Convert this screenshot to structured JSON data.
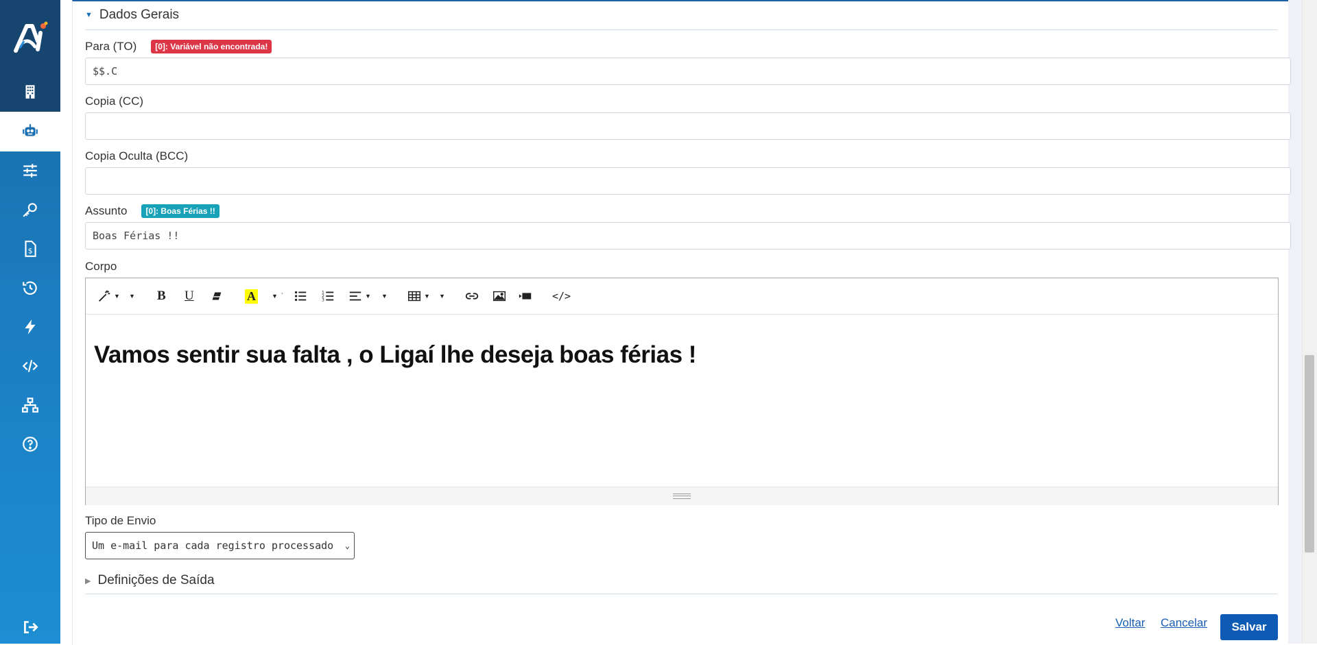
{
  "sidebar": {
    "items": [
      {
        "name": "building-icon"
      },
      {
        "name": "robot-icon",
        "active": true
      },
      {
        "name": "sliders-icon"
      },
      {
        "name": "key-icon"
      },
      {
        "name": "invoice-icon"
      },
      {
        "name": "history-icon"
      },
      {
        "name": "bolt-icon"
      },
      {
        "name": "code-icon"
      },
      {
        "name": "network-icon"
      },
      {
        "name": "help-icon"
      },
      {
        "name": "logout-icon"
      }
    ]
  },
  "section": {
    "title": "Dados Gerais",
    "section2_title": "Definições de Saída"
  },
  "fields": {
    "to_label": "Para (TO)",
    "to_badge": "[0]: Variável não encontrada!",
    "to_value": "$$.C",
    "cc_label": "Copia (CC)",
    "cc_value": "",
    "bcc_label": "Copia Oculta (BCC)",
    "bcc_value": "",
    "subject_label": "Assunto",
    "subject_badge": "[0]: Boas Férias !!",
    "subject_value": "Boas Férias !!",
    "body_label": "Corpo",
    "body_content": "Vamos sentir sua falta , o Ligaí lhe deseja boas férias !",
    "send_type_label": "Tipo de Envio",
    "send_type_value": "Um e-mail para cada registro processado"
  },
  "actions": {
    "back": "Voltar",
    "cancel": "Cancelar",
    "save": "Salvar"
  },
  "colors": {
    "primary": "#0d5bb5",
    "badge_error": "#dc3545",
    "badge_info": "#17a2b8",
    "sidebar_dark": "#16456f"
  }
}
